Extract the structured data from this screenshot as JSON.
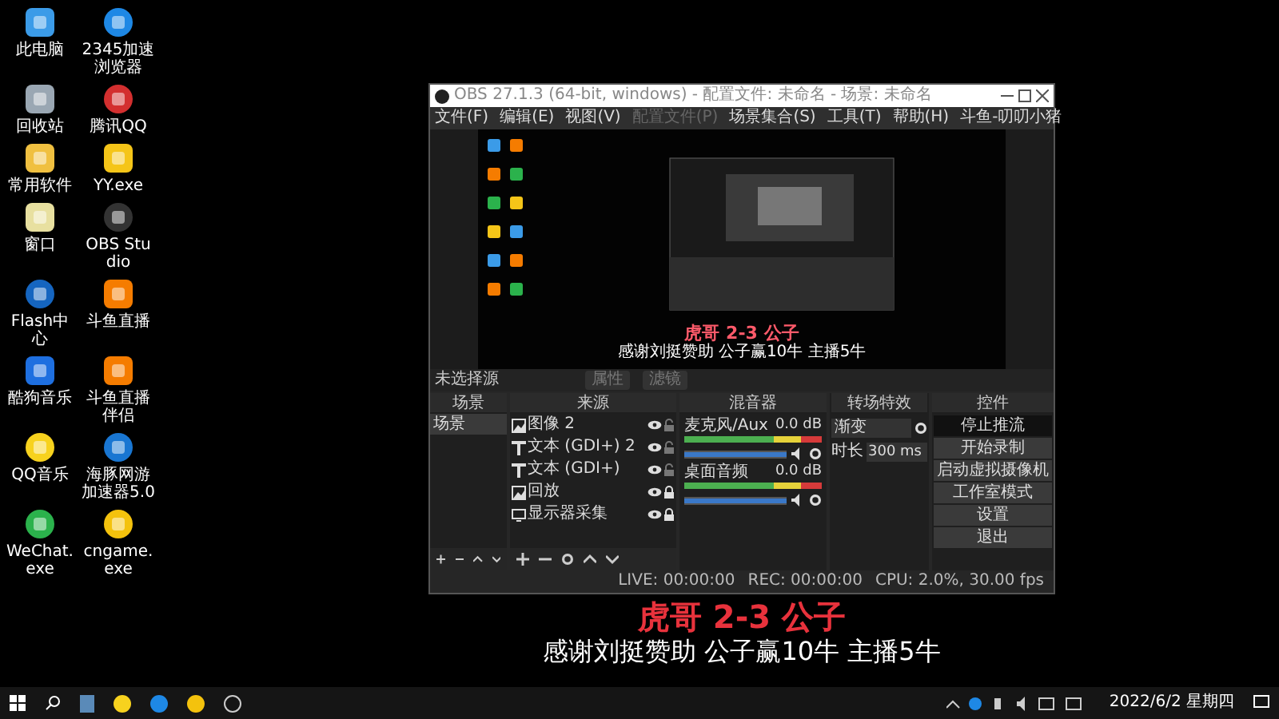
{
  "desktop_icons": [
    {
      "label": "此电脑"
    },
    {
      "label": "2345加速浏览器"
    },
    {
      "label": "回收站"
    },
    {
      "label": "腾讯QQ"
    },
    {
      "label": "常用软件"
    },
    {
      "label": "YY.exe"
    },
    {
      "label": "窗口"
    },
    {
      "label": "OBS Studio"
    },
    {
      "label": "Flash中心"
    },
    {
      "label": "斗鱼直播"
    },
    {
      "label": "酷狗音乐"
    },
    {
      "label": "斗鱼直播伴侣"
    },
    {
      "label": "QQ音乐"
    },
    {
      "label": "海豚网游加速器5.0"
    },
    {
      "label": "WeChat.exe"
    },
    {
      "label": "cngame.exe"
    }
  ],
  "obs": {
    "title": "OBS 27.1.3 (64-bit, windows) - 配置文件: 未命名 - 场景: 未命名",
    "menu": [
      {
        "label": "文件(F)",
        "disabled": false
      },
      {
        "label": "编辑(E)",
        "disabled": false
      },
      {
        "label": "视图(V)",
        "disabled": false
      },
      {
        "label": "配置文件(P)",
        "disabled": true
      },
      {
        "label": "场景集合(S)",
        "disabled": false
      },
      {
        "label": "工具(T)",
        "disabled": false
      },
      {
        "label": "帮助(H)",
        "disabled": false
      },
      {
        "label": "斗鱼-叨叨小猪",
        "disabled": false
      }
    ],
    "preview": {
      "headline": "虎哥 2-3 公子",
      "subtitle": "感谢刘挺赞助 公子赢10牛 主播5牛"
    },
    "source_bar": {
      "label": "未选择源",
      "buttons": [
        {
          "label": "属性",
          "disabled": true
        },
        {
          "label": "滤镜",
          "disabled": true
        }
      ]
    },
    "scenes": {
      "title": "场景",
      "items": [
        {
          "label": "场景",
          "selected": true
        }
      ]
    },
    "sources": {
      "title": "来源",
      "items": [
        {
          "label": "图像 2",
          "kind": "image",
          "locked": false
        },
        {
          "label": "文本 (GDI+) 2",
          "kind": "text",
          "locked": false
        },
        {
          "label": "文本 (GDI+)",
          "kind": "text",
          "locked": false
        },
        {
          "label": "回放",
          "kind": "image",
          "locked": true
        },
        {
          "label": "显示器采集",
          "kind": "display",
          "locked": true
        }
      ]
    },
    "mixer": {
      "title": "混音器",
      "channels": [
        {
          "name": "麦克风/Aux",
          "reading": "0.0 dB",
          "level": 1
        },
        {
          "name": "桌面音频",
          "reading": "0.0 dB",
          "level": 1
        }
      ]
    },
    "transitions": {
      "title": "转场特效",
      "transition": "渐变",
      "duration_label": "时长",
      "duration": "300 ms"
    },
    "controls": {
      "title": "控件",
      "buttons": [
        {
          "label": "停止推流",
          "pressed": true
        },
        {
          "label": "开始录制",
          "pressed": false
        },
        {
          "label": "启动虚拟摄像机",
          "pressed": false
        },
        {
          "label": "工作室模式",
          "pressed": false
        },
        {
          "label": "设置",
          "pressed": false
        },
        {
          "label": "退出",
          "pressed": false
        }
      ]
    },
    "status_bar": {
      "live": "LIVE: 00:00:00",
      "rec": "REC: 00:00:00",
      "cpu": "CPU: 2.0%, 30.00 fps"
    }
  },
  "overlay": {
    "headline": "虎哥 2-3 公子",
    "subtitle": "感谢刘挺赞助 公子赢10牛 主播5牛"
  },
  "taskbar": {
    "date": "2022/6/2 星期四"
  }
}
